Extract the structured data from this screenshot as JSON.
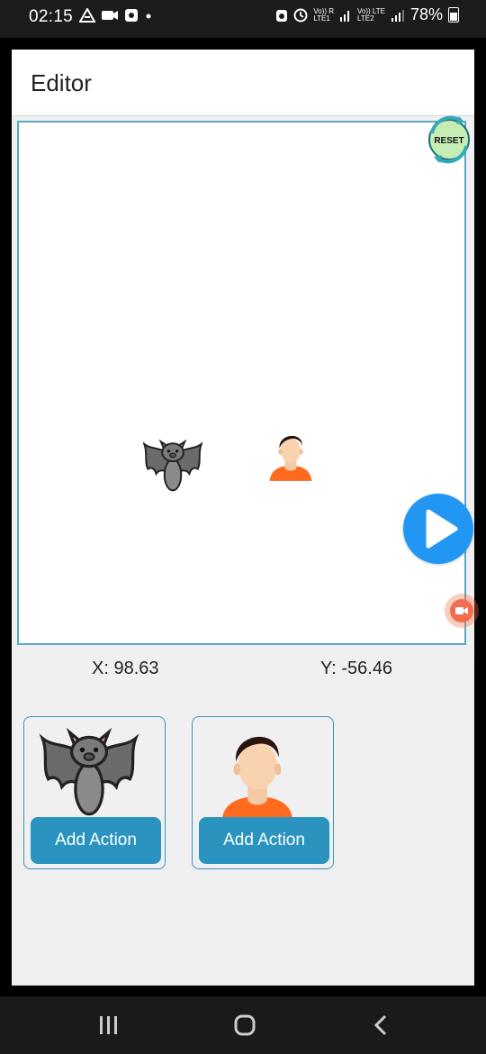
{
  "status_bar": {
    "time": "02:15",
    "battery": "78%",
    "sim1": "Vo)) R\nLTE1",
    "sim2": "Vo)) LTE\nLTE2"
  },
  "app_bar": {
    "title": "Editor"
  },
  "stage": {
    "reset_label": "RESET",
    "play_icon": "play-icon",
    "sprites": [
      "bat",
      "person"
    ]
  },
  "coordinates": {
    "x_text": "X: 98.63",
    "y_text": "Y: -56.46"
  },
  "cards": [
    {
      "sprite": "bat",
      "button_label": "Add Action"
    },
    {
      "sprite": "person",
      "button_label": "Add Action"
    }
  ],
  "colors": {
    "accent": "#2a93bf",
    "play": "#2196f3",
    "canvas_border": "#5aa8c2",
    "background": "#f0f0f0"
  }
}
